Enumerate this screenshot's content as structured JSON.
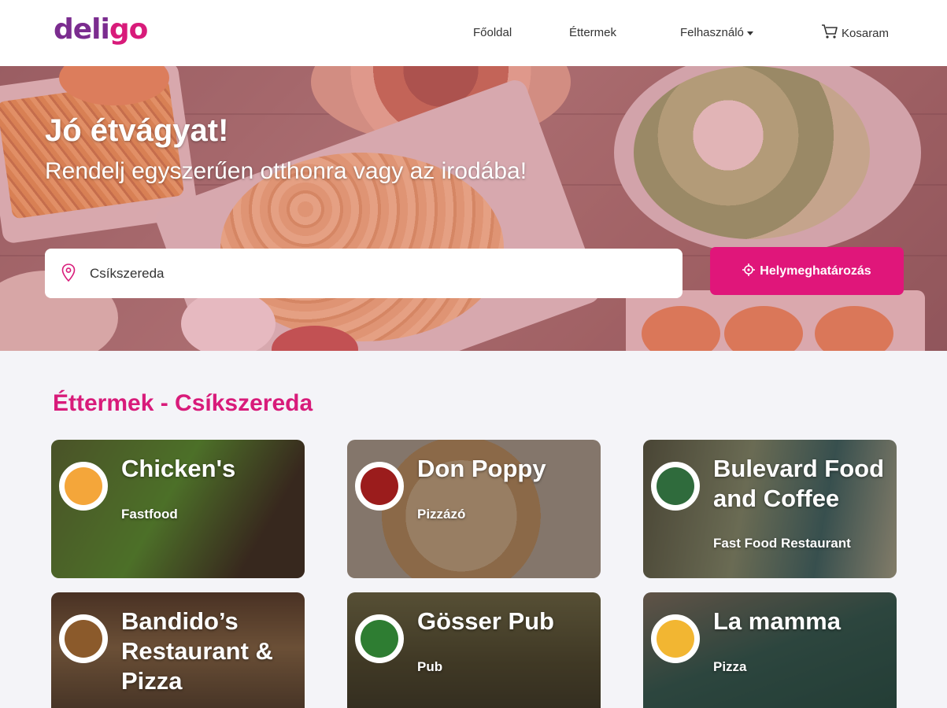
{
  "brand": {
    "logo_part1": "deli",
    "logo_part2": "go",
    "color_primary": "#d81b7a",
    "color_secondary": "#7b2c8f"
  },
  "nav": {
    "home": "Főoldal",
    "restaurants": "Éttermek",
    "user": "Felhasználó",
    "cart": "Kosaram"
  },
  "hero": {
    "title": "Jó étvágyat!",
    "subtitle": "Rendelj egyszerűen otthonra vagy az irodába!",
    "search_value": "Csíkszereda",
    "locate_button": "Helymeghatározás"
  },
  "section": {
    "title": "Éttermek - Csíkszereda"
  },
  "restaurants": [
    {
      "name": "Chicken's",
      "type": "Fastfood",
      "logo_color": "#f4a63a"
    },
    {
      "name": "Don Poppy",
      "type": "Pizzázó",
      "logo_color": "#9b1c1c"
    },
    {
      "name": "Bulevard Food and Coffee",
      "type": "Fast Food Restaurant",
      "logo_color": "#2f6b3c"
    },
    {
      "name": "Bandido’s Restaurant & Pizza",
      "type": "",
      "logo_color": "#8b5a2b"
    },
    {
      "name": "Gösser Pub",
      "type": "Pub",
      "logo_color": "#2e7d32"
    },
    {
      "name": "La mamma",
      "type": "Pizza",
      "logo_color": "#f2b632"
    }
  ]
}
